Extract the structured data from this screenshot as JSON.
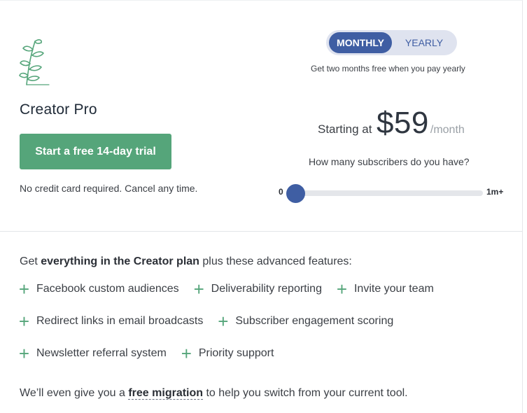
{
  "plan": {
    "name": "Creator Pro",
    "trial_button": "Start a free 14-day trial",
    "trial_note": "No credit card required. Cancel any time."
  },
  "billing": {
    "monthly_label": "MONTHLY",
    "yearly_label": "YEARLY",
    "selected": "MONTHLY",
    "note": "Get two months free when you pay yearly"
  },
  "pricing": {
    "starting_label": "Starting at",
    "price": "$59",
    "period": "/month"
  },
  "subscribers": {
    "question": "How many subscribers do you have?",
    "min_label": "0",
    "max_label": "1m+",
    "slider_value": 0
  },
  "features": {
    "intro_prefix": "Get ",
    "intro_bold": "everything in the Creator plan",
    "intro_suffix": " plus these advanced features:",
    "items": [
      "Facebook custom audiences",
      "Deliverability reporting",
      "Invite your team",
      "Redirect links in email broadcasts",
      "Subscriber engagement scoring",
      "Newsletter referral system",
      "Priority support"
    ]
  },
  "migration": {
    "prefix": "We’ll even give you a ",
    "link": "free migration",
    "suffix": " to help you switch from your current tool."
  },
  "colors": {
    "accent_green": "#55a57a",
    "accent_blue": "#3f5ea3",
    "toggle_bg": "#dfe3ef"
  },
  "icons": {
    "logo": "sprout-icon",
    "feature_bullet": "plus-icon"
  }
}
